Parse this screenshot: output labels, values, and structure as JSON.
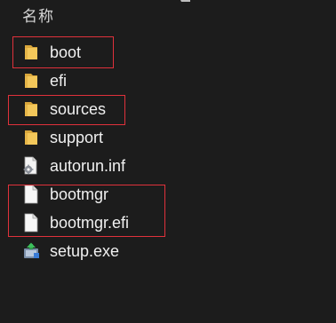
{
  "header": {
    "name_column": "名称"
  },
  "files": [
    {
      "name": "boot",
      "icon": "folder-icon"
    },
    {
      "name": "efi",
      "icon": "folder-icon"
    },
    {
      "name": "sources",
      "icon": "folder-icon"
    },
    {
      "name": "support",
      "icon": "folder-icon"
    },
    {
      "name": "autorun.inf",
      "icon": "settings-file-icon"
    },
    {
      "name": "bootmgr",
      "icon": "file-icon"
    },
    {
      "name": "bootmgr.efi",
      "icon": "file-icon"
    },
    {
      "name": "setup.exe",
      "icon": "setup-app-icon"
    }
  ],
  "colors": {
    "background": "#1c1c1c",
    "highlight": "#e0313b",
    "folder": "#f3c75a"
  }
}
